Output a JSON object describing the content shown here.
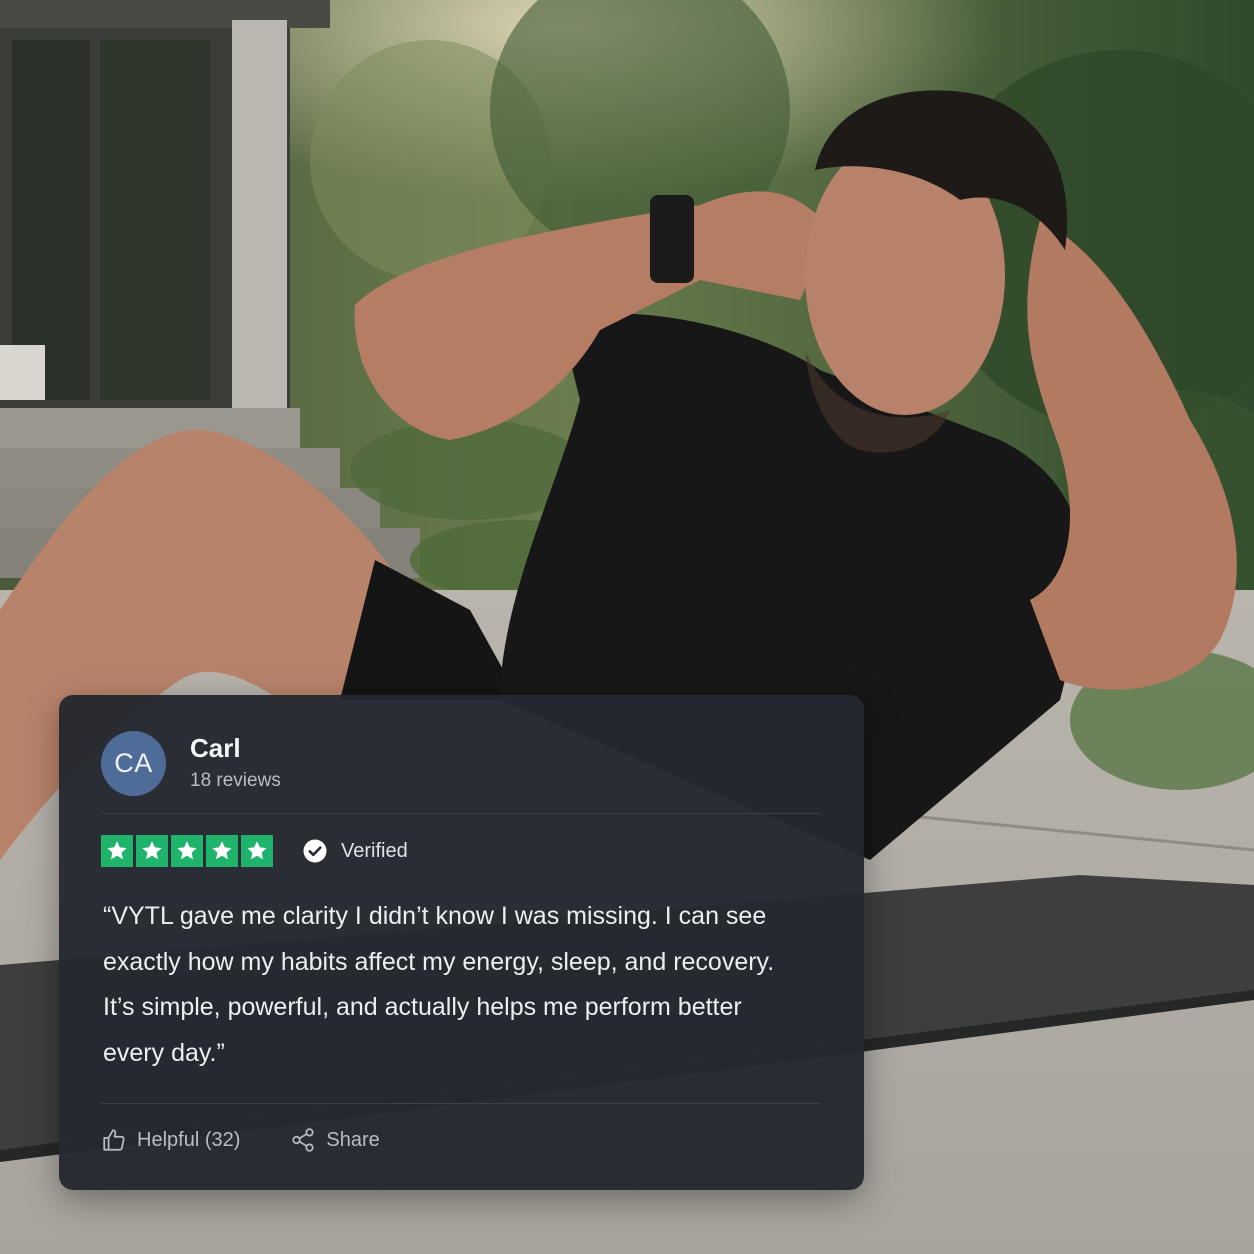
{
  "review": {
    "avatar_initials": "CA",
    "reviewer_name": "Carl",
    "review_count": "18 reviews",
    "rating_stars": 5,
    "rating_max": 5,
    "verified_label": "Verified",
    "text": "“VYTL gave me clarity I didn’t know I was missing. I can see exactly how my habits affect my energy, sleep, and recovery. It’s simple, powerful, and actually helps me perform better every day.”",
    "helpful_label": "Helpful (32)",
    "share_label": "Share"
  },
  "colors": {
    "card_background": "#252830",
    "star_green": "#1fb36b",
    "avatar_blue": "#4f6c98"
  },
  "icons": {
    "star": "star-icon",
    "verified": "check-circle-icon",
    "helpful": "thumbs-up-icon",
    "share": "share-icon"
  }
}
